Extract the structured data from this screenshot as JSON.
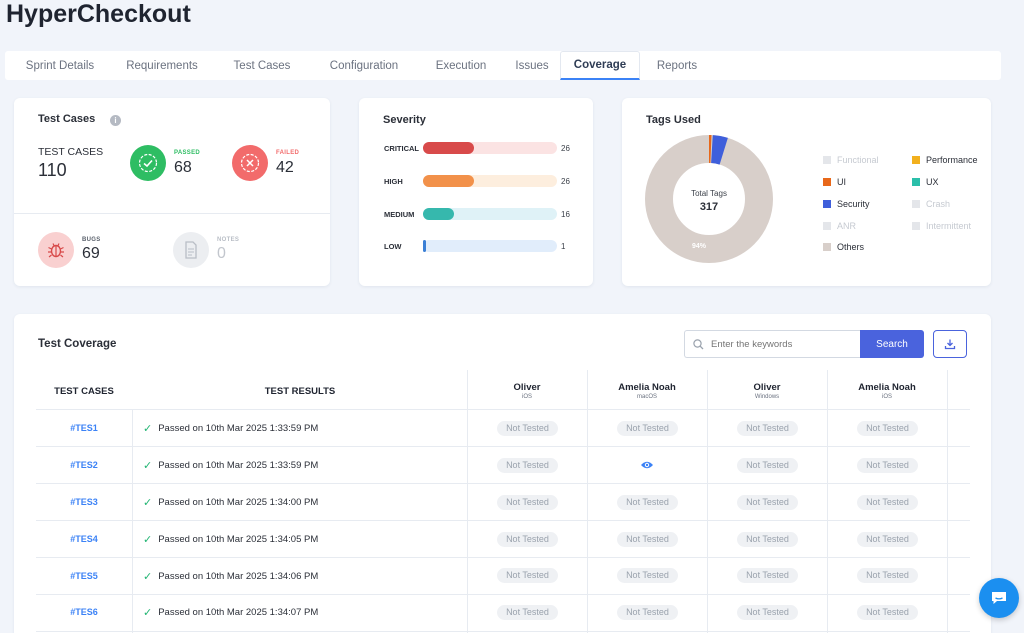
{
  "app": {
    "title": "HyperCheckout"
  },
  "tabs": [
    {
      "label": "Sprint Details"
    },
    {
      "label": "Requirements"
    },
    {
      "label": "Test Cases"
    },
    {
      "label": "Configuration"
    },
    {
      "label": "Execution"
    },
    {
      "label": "Issues"
    },
    {
      "label": "Coverage",
      "active": true
    },
    {
      "label": "Reports"
    }
  ],
  "test_cases_card": {
    "title": "Test Cases",
    "info_icon": "info-icon",
    "total_label": "TEST CASES",
    "total_value": "110",
    "passed_label": "PASSED",
    "passed_value": "68",
    "failed_label": "FAILED",
    "failed_value": "42",
    "bugs_label": "BUGS",
    "bugs_value": "69",
    "notes_label": "NOTES",
    "notes_value": "0",
    "colors": {
      "passed": "#2ebd63",
      "failed": "#f26b6b",
      "bugs": "#f7c7c7",
      "notes": "#eceef1"
    }
  },
  "severity_card": {
    "title": "Severity",
    "max": 26,
    "levels": [
      {
        "label": "CRITICAL",
        "value": "26",
        "color": "#d84a4a",
        "track": "#fbe3e3"
      },
      {
        "label": "HIGH",
        "value": "26",
        "color": "#f2914a",
        "track": "#fdeede"
      },
      {
        "label": "MEDIUM",
        "value": "16",
        "color": "#36b8ad",
        "track": "#dff2f7"
      },
      {
        "label": "LOW",
        "value": "1",
        "color": "#3a7fd5",
        "track": "#e1edfb"
      }
    ]
  },
  "tags_card": {
    "title": "Tags Used",
    "donut_center_label": "Total Tags",
    "donut_center_value": "317",
    "donut_segment_label": "94%",
    "others_percent": 94,
    "legend": [
      {
        "label": "Functional",
        "color": "#e4e6ea",
        "muted": true
      },
      {
        "label": "Performance",
        "color": "#f2b01e",
        "muted": false
      },
      {
        "label": "UI",
        "color": "#e8681a",
        "muted": false
      },
      {
        "label": "UX",
        "color": "#2bbfaa",
        "muted": false
      },
      {
        "label": "Security",
        "color": "#3f5fdb",
        "muted": false
      },
      {
        "label": "Crash",
        "color": "#e4e6ea",
        "muted": true
      },
      {
        "label": "ANR",
        "color": "#e4e6ea",
        "muted": true
      },
      {
        "label": "Intermittent",
        "color": "#e4e6ea",
        "muted": true
      },
      {
        "label": "Others",
        "color": "#d8cfca",
        "muted": false
      }
    ]
  },
  "coverage": {
    "title": "Test Coverage",
    "search_placeholder": "Enter the keywords",
    "search_button": "Search",
    "download_icon": "download-icon",
    "headers": {
      "test_cases": "TEST CASES",
      "test_results": "TEST RESULTS",
      "columns": [
        {
          "name": "Oliver",
          "platform": "iOS"
        },
        {
          "name": "Amelia Noah",
          "platform": "macOS"
        },
        {
          "name": "Oliver",
          "platform": "Windows"
        },
        {
          "name": "Amelia Noah",
          "platform": "iOS"
        }
      ]
    },
    "rows": [
      {
        "id": "#TES1",
        "result": "Passed on 10th Mar 2025 1:33:59 PM",
        "cells": [
          "Not Tested",
          "Not Tested",
          "Not Tested",
          "Not Tested"
        ]
      },
      {
        "id": "#TES2",
        "result": "Passed on 10th Mar 2025 1:33:59 PM",
        "cells": [
          "Not Tested",
          "eye-icon",
          "Not Tested",
          "Not Tested"
        ]
      },
      {
        "id": "#TES3",
        "result": "Passed on 10th Mar 2025 1:34:00 PM",
        "cells": [
          "Not Tested",
          "Not Tested",
          "Not Tested",
          "Not Tested"
        ]
      },
      {
        "id": "#TES4",
        "result": "Passed on 10th Mar 2025 1:34:05 PM",
        "cells": [
          "Not Tested",
          "Not Tested",
          "Not Tested",
          "Not Tested"
        ]
      },
      {
        "id": "#TES5",
        "result": "Passed on 10th Mar 2025 1:34:06 PM",
        "cells": [
          "Not Tested",
          "Not Tested",
          "Not Tested",
          "Not Tested"
        ]
      },
      {
        "id": "#TES6",
        "result": "Passed on 10th Mar 2025 1:34:07 PM",
        "cells": [
          "Not Tested",
          "Not Tested",
          "Not Tested",
          "Not Tested"
        ]
      }
    ]
  },
  "chat": {
    "icon": "chat-icon"
  }
}
